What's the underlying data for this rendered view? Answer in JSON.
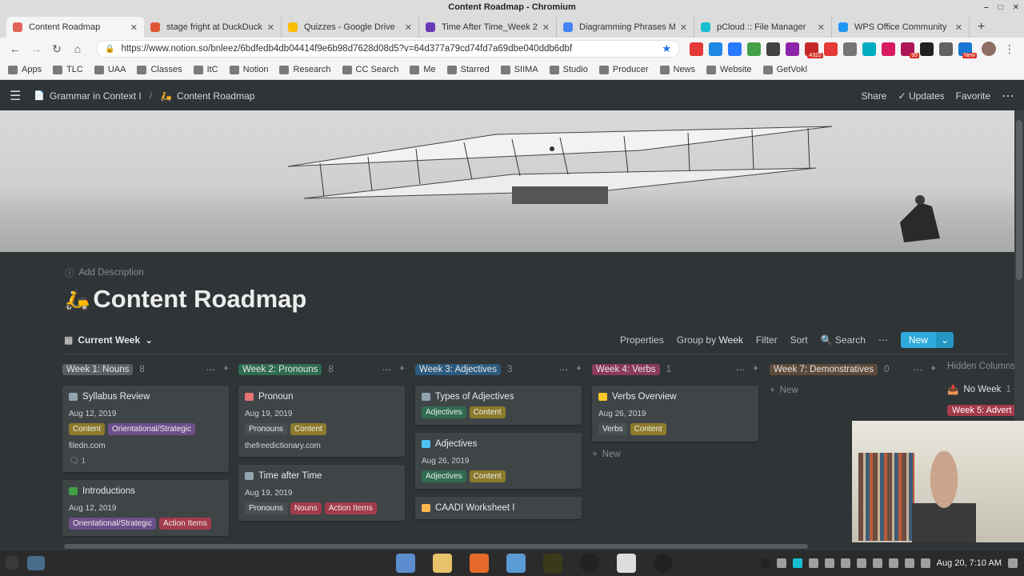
{
  "window": {
    "title": "Content Roadmap - Chromium"
  },
  "tabs": [
    {
      "label": "Content Roadmap",
      "color": "#e16259",
      "active": true
    },
    {
      "label": "stage fright at DuckDuckGo",
      "color": "#de5833",
      "active": false
    },
    {
      "label": "Quizzes - Google Drive",
      "color": "#fbbc04",
      "active": false
    },
    {
      "label": "Time After Time_Week 2",
      "color": "#673ab7",
      "active": false
    },
    {
      "label": "Diagramming Phrases Ma",
      "color": "#4285f4",
      "active": false
    },
    {
      "label": "pCloud :: File Manager",
      "color": "#17bed0",
      "active": false
    },
    {
      "label": "WPS Office Community",
      "color": "#2196f3",
      "active": false
    }
  ],
  "omnibox": {
    "url": "https://www.notion.so/bnleez/6bdfedb4db04414f9e6b98d7628d08d5?v=64d377a79cd74fd7a69dbe040ddb6dbf"
  },
  "extensions": [
    {
      "color": "#e53935",
      "badge": ""
    },
    {
      "color": "#1e88e5",
      "badge": ""
    },
    {
      "color": "#2979ff",
      "badge": ""
    },
    {
      "color": "#43a047",
      "badge": ""
    },
    {
      "color": "#424242",
      "badge": ""
    },
    {
      "color": "#8e24aa",
      "badge": ""
    },
    {
      "color": "#c62828",
      "badge": "4322"
    },
    {
      "color": "#e53935",
      "badge": ""
    },
    {
      "color": "#757575",
      "badge": ""
    },
    {
      "color": "#00acc1",
      "badge": ""
    },
    {
      "color": "#d81b60",
      "badge": ""
    },
    {
      "color": "#ad1457",
      "badge": "95"
    },
    {
      "color": "#212121",
      "badge": ""
    },
    {
      "color": "#616161",
      "badge": ""
    },
    {
      "color": "#1976d2",
      "badge": "New"
    }
  ],
  "bookmarks": [
    "Apps",
    "TLC",
    "UAA",
    "Classes",
    "ItC",
    "Notion",
    "Research",
    "CC Search",
    "Me",
    "Starred",
    "SIIMA",
    "Studio",
    "Producer",
    "News",
    "Website",
    "GetVokl"
  ],
  "notion": {
    "breadcrumb": [
      "Grammar in Context I",
      "Content Roadmap"
    ],
    "actions": {
      "share": "Share",
      "updates": "Updates",
      "favorite": "Favorite"
    },
    "add_description": "Add Description",
    "page_title": "Content Roadmap",
    "view": {
      "name": "Current Week",
      "properties": "Properties",
      "group_by": "Group by",
      "group_value": "Week",
      "filter": "Filter",
      "sort": "Sort",
      "search": "Search",
      "new": "New"
    }
  },
  "columns": [
    {
      "name": "Week 1: Nouns",
      "count": "8",
      "color": "#5a5f63",
      "cards": [
        {
          "title": "Syllabus Review",
          "icon": "#90a4ae",
          "date": "Aug 12, 2019",
          "tags": [
            {
              "label": "Content",
              "color": "#8b7a2b"
            },
            {
              "label": "Orientational/Strategic",
              "color": "#6b4f8a"
            }
          ],
          "link": "filedn.com",
          "comments": "1"
        },
        {
          "title": "Introductions",
          "icon": "#43a047",
          "date": "Aug 12, 2019",
          "tags": [
            {
              "label": "Orientational/Strategic",
              "color": "#6b4f8a"
            },
            {
              "label": "Action Items",
              "color": "#a33b4b"
            }
          ],
          "link": "",
          "comments": ""
        }
      ]
    },
    {
      "name": "Week 2: Pronouns",
      "count": "8",
      "color": "#2f6b4f",
      "cards": [
        {
          "title": "Pronoun",
          "icon": "#e57373",
          "date": "Aug 19, 2019",
          "tags": [
            {
              "label": "Pronouns",
              "color": "#4a4f52"
            },
            {
              "label": "Content",
              "color": "#8b7a2b"
            }
          ],
          "link": "thefreedictionary.com",
          "comments": ""
        },
        {
          "title": "Time after Time",
          "icon": "#90a4ae",
          "date": "Aug 19, 2019",
          "tags": [
            {
              "label": "Pronouns",
              "color": "#4a4f52"
            },
            {
              "label": "Nouns",
              "color": "#a33b4b"
            },
            {
              "label": "Action Items",
              "color": "#a33b4b"
            }
          ],
          "link": "",
          "comments": ""
        }
      ]
    },
    {
      "name": "Week 3: Adjectives",
      "count": "3",
      "color": "#2d5a7c",
      "cards": [
        {
          "title": "Types of Adjectives",
          "icon": "#90a4ae",
          "date": "",
          "tags": [
            {
              "label": "Adjectives",
              "color": "#2f6b4f"
            },
            {
              "label": "Content",
              "color": "#8b7a2b"
            }
          ],
          "link": "",
          "comments": ""
        },
        {
          "title": "Adjectives",
          "icon": "#4fc3f7",
          "date": "Aug 26, 2019",
          "tags": [
            {
              "label": "Adjectives",
              "color": "#2f6b4f"
            },
            {
              "label": "Content",
              "color": "#8b7a2b"
            }
          ],
          "link": "",
          "comments": ""
        },
        {
          "title": "CAADI Worksheet I",
          "icon": "#ffb74d",
          "date": "",
          "tags": [],
          "link": "",
          "comments": ""
        }
      ]
    },
    {
      "name": "Week 4: Verbs",
      "count": "1",
      "color": "#8a3a5a",
      "cards": [
        {
          "title": "Verbs Overview",
          "icon": "#ffca28",
          "date": "Aug 26, 2019",
          "tags": [
            {
              "label": "Verbs",
              "color": "#4a4f52"
            },
            {
              "label": "Content",
              "color": "#8b7a2b"
            }
          ],
          "link": "",
          "comments": ""
        }
      ],
      "add_new": "New"
    },
    {
      "name": "Week 7: Demonstratives",
      "count": "0",
      "color": "#5e4a3a",
      "cards": [],
      "add_new": "New"
    }
  ],
  "hidden_columns": {
    "label": "Hidden Columns",
    "items": [
      {
        "label": "No Week",
        "count": "1"
      }
    ],
    "partial_tag": "Week 5: Advert"
  },
  "taskbar": {
    "clock": "Aug 20, 7:10 AM"
  }
}
